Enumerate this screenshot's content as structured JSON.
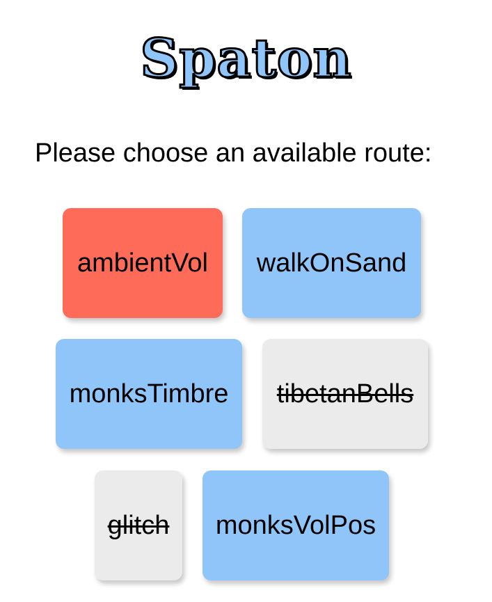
{
  "app": {
    "title": "Spaton"
  },
  "prompt": "Please choose an available route:",
  "routes": [
    {
      "label": "ambientVol",
      "state": "active"
    },
    {
      "label": "walkOnSand",
      "state": "available"
    },
    {
      "label": "monksTimbre",
      "state": "available"
    },
    {
      "label": "tibetanBells",
      "state": "unavailable"
    },
    {
      "label": "glitch",
      "state": "unavailable"
    },
    {
      "label": "monksVolPos",
      "state": "available"
    }
  ],
  "colors": {
    "active": "#fe6b59",
    "available": "#90c5f9",
    "unavailable": "#ebebeb",
    "logo_fill": "#90c5f9",
    "logo_outline": "#000000"
  }
}
